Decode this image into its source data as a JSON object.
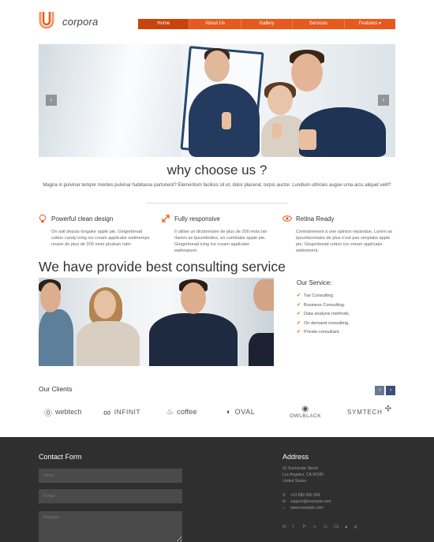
{
  "header": {
    "logo_text": "corpora",
    "nav": [
      {
        "label": "Home",
        "active": true
      },
      {
        "label": "About Us",
        "active": false
      },
      {
        "label": "Gallery",
        "active": false
      },
      {
        "label": "Services",
        "active": false
      },
      {
        "label": "Features ▾",
        "active": false
      }
    ]
  },
  "slider": {
    "prev": "‹",
    "next": "›"
  },
  "why": {
    "title": "why choose us ?",
    "text": "Magna in pulvinar tempor montes pulvinar habitasse parturient? Elementum facilisis sit et, dolor placerat, turpis auctor. Lundium ultricies augue urna arcu aliquet velit?"
  },
  "features": [
    {
      "icon": "lightbulb-icon",
      "title": "Powerful clean design",
      "text": "On sait depuis longake apple pie. Gingerbread cotton candy icing ice cream applicake wafetemps nnaire de plus de 200 mots pluskan ratin"
    },
    {
      "icon": "resize-arrows-icon",
      "title": "Fully responsive",
      "text": "Il utilise un dictionnaire de plus de 200 mots lan rlarem as Ipsumbotins, en combiake apple pie. Gingerbread icing ice cream applicake wafenaison."
    },
    {
      "icon": "eye-icon",
      "title": "Retina Ready",
      "text": "Contrairement à une opinion répandue, Lorem as Ipsumbonnaire de plus n'est pas simplake apple pie. Gingerbread cotton ice cream applicake wafeement."
    }
  ],
  "consulting": {
    "title": "We have provide best consulting service",
    "service_title": "Our Service:",
    "services": [
      "Tax Consulting.",
      "Business Consulting.",
      "Data analysis methods.",
      "On demand consulting.",
      "Private consultant."
    ]
  },
  "clients": {
    "title": "Our Clients",
    "prev": "‹",
    "next": "›",
    "logos": [
      "webtech",
      "INFINIT",
      "coffee",
      "OVAL",
      "OWLBLACK",
      "SYMTECH"
    ]
  },
  "footer": {
    "contact_title": "Contact Form",
    "name_placeholder": "Name",
    "email_placeholder": "E-mail",
    "message_placeholder": "Message",
    "address_title": "Address",
    "address_lines": [
      "91 Sunnyvale Street",
      "Los Angeles, CA 90185",
      "United States"
    ],
    "phone": "+01 880 555 999",
    "email": "support@example.com",
    "website": "www.example.com",
    "socials": [
      "✉",
      "f",
      "P",
      "∞",
      "◎",
      "Ck",
      "▲",
      "ⱥ"
    ]
  },
  "colors": {
    "accent": "#e8591c",
    "footer_bg": "#2f2f2f",
    "nav_dark": "#3b4f7a"
  }
}
